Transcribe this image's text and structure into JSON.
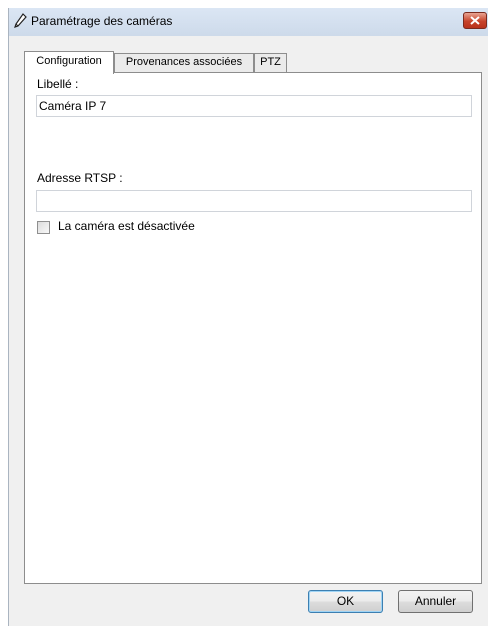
{
  "window": {
    "title": "Paramétrage des caméras"
  },
  "tabs": [
    {
      "label": "Configuration",
      "active": true
    },
    {
      "label": "Provenances associées",
      "active": false
    },
    {
      "label": "PTZ",
      "active": false
    }
  ],
  "form": {
    "libelle_label": "Libellé :",
    "libelle_value": "Caméra IP 7",
    "rtsp_label": "Adresse RTSP :",
    "rtsp_value": "",
    "disabled_checkbox_label": "La caméra est désactivée",
    "disabled_checked": false
  },
  "buttons": {
    "ok": "OK",
    "cancel": "Annuler"
  },
  "colors": {
    "close_button": "#c7432a",
    "titlebar": "#d6e2f1",
    "dialog_background": "#f0f0f0"
  },
  "icons": {
    "title": "pencil-icon",
    "close": "close-icon"
  }
}
